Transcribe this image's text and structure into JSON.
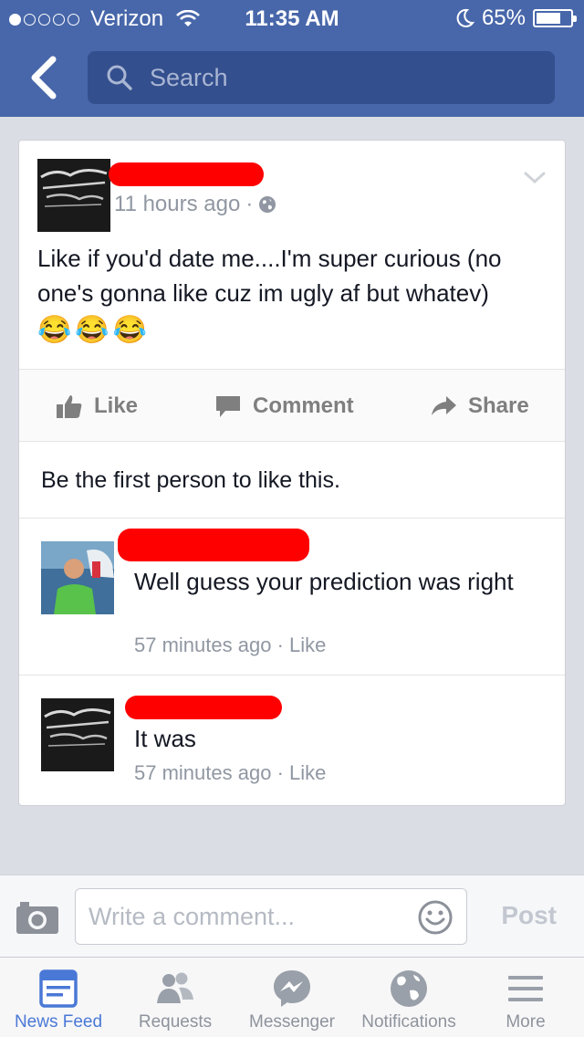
{
  "status_bar": {
    "carrier": "Verizon",
    "time": "11:35 AM",
    "battery": "65%",
    "battery_level": 0.65,
    "signal_dots_filled": 1
  },
  "nav": {
    "search_placeholder": "Search"
  },
  "post": {
    "time": "11 hours ago",
    "separator": "·",
    "text": "Like if you'd date me....I'm super curious (no one's gonna like cuz im ugly af but whatev)",
    "emojis": [
      "😂",
      "😂",
      "😂"
    ]
  },
  "actions": {
    "like": "Like",
    "comment": "Comment",
    "share": "Share"
  },
  "likes_text": "Be the first person to like this.",
  "comments": [
    {
      "text": "Well guess your prediction was right",
      "time": "57 minutes ago",
      "separator": "·",
      "like": "Like"
    },
    {
      "text": "It was",
      "time": "57 minutes ago",
      "separator": "·",
      "like": "Like"
    }
  ],
  "composer": {
    "placeholder": "Write a comment...",
    "post": "Post"
  },
  "tabs": [
    {
      "label": "News Feed",
      "icon": "news-feed-icon",
      "active": true
    },
    {
      "label": "Requests",
      "icon": "friend-requests-icon",
      "active": false
    },
    {
      "label": "Messenger",
      "icon": "messenger-icon",
      "active": false
    },
    {
      "label": "Notifications",
      "icon": "globe-icon",
      "active": false
    },
    {
      "label": "More",
      "icon": "menu-icon",
      "active": false
    }
  ],
  "colors": {
    "nav_blue": "#4867aa",
    "active_tab": "#4a78d6",
    "redaction": "#ff0000"
  }
}
